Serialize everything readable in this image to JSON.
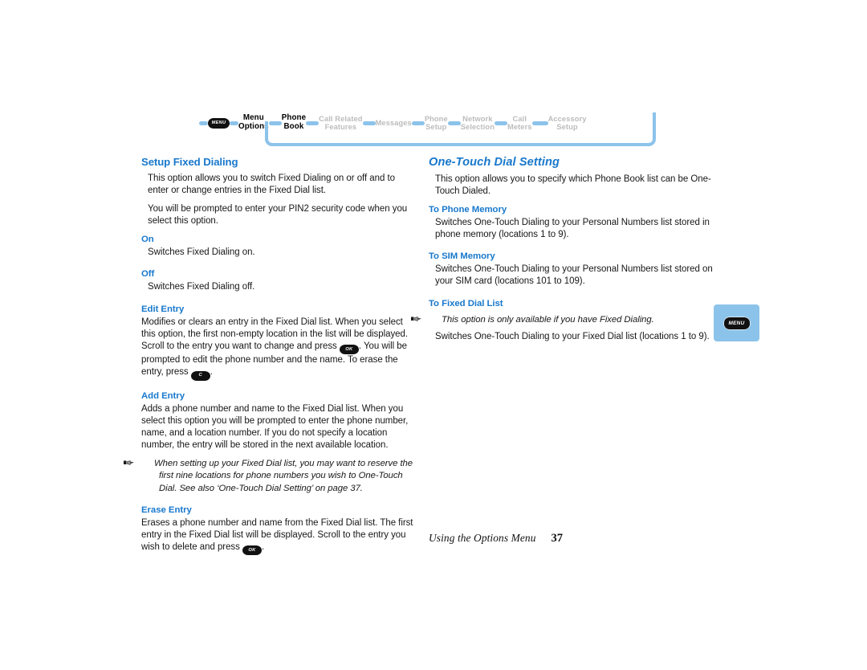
{
  "nav": {
    "menu_icon_label": "MENU",
    "items": [
      {
        "lines": [
          "Menu",
          "Options"
        ],
        "state": "active"
      },
      {
        "lines": [
          "Phone",
          "Book"
        ],
        "state": "active"
      },
      {
        "lines": [
          "Call Related",
          "Features"
        ],
        "state": "dim"
      },
      {
        "lines": [
          "Messages"
        ],
        "state": "dim"
      },
      {
        "lines": [
          "Phone",
          "Setup"
        ],
        "state": "dim"
      },
      {
        "lines": [
          "Network",
          "Selection"
        ],
        "state": "dim"
      },
      {
        "lines": [
          "Call",
          "Meters"
        ],
        "state": "dim"
      },
      {
        "lines": [
          "Accessory",
          "Setup"
        ],
        "state": "dim"
      }
    ]
  },
  "colors": {
    "heading_blue": "#1878cc",
    "connector_blue": "#8cc3ea",
    "dim_gray": "#bcbcbc",
    "body_text": "#171717"
  },
  "left_column": {
    "title": "Setup Fixed Dialing",
    "intro_1": "This option allows you to switch Fixed Dialing on or off and to enter or change entries in the Fixed Dial list.",
    "intro_2": "You will be prompted to enter your PIN2 security code when you select this option.",
    "on": {
      "title": "On",
      "body": "Switches Fixed Dialing on."
    },
    "off": {
      "title": "Off",
      "body": "Switches Fixed Dialing off."
    },
    "edit_entry": {
      "title": "Edit Entry",
      "body_part1": "Modifies or clears an entry in the Fixed Dial list. When you select this option, the first non-empty location in the list will be displayed. Scroll to the entry you want to change and press",
      "key_ok": "OK",
      "body_part2": ". You will be prompted to edit the phone number and the name. To erase the entry, press",
      "key_c": "C",
      "body_part3": "."
    },
    "add_entry": {
      "title": "Add Entry",
      "body": "Adds a phone number and name to the Fixed Dial list. When you select this option you will be prompted to enter the phone number, name, and a location number. If you do not specify a location number, the entry will be stored in the next available location.",
      "note": "When setting up your Fixed Dial list, you may want to reserve the first nine locations for phone numbers you wish to One-Touch Dial. See also ‘One-Touch Dial Setting’ on page 37."
    },
    "erase_entry": {
      "title": "Erase Entry",
      "body_part1": "Erases a phone number and name from the Fixed Dial list. The first entry in the Fixed Dial list will be displayed. Scroll to the entry you wish to delete and press",
      "key_ok": "OK",
      "body_part2": "."
    }
  },
  "right_column": {
    "title": "One-Touch Dial Setting",
    "intro": "This option allows you to specify which Phone Book list can be One-Touch Dialed.",
    "to_phone_memory": {
      "title": "To Phone Memory",
      "body": "Switches One-Touch Dialing to your Personal Numbers list stored in phone memory (locations 1 to 9)."
    },
    "to_sim_memory": {
      "title": "To SIM Memory",
      "body": "Switches One-Touch Dialing to your Personal Numbers list stored on your SIM card (locations 101 to 109)."
    },
    "to_fixed_dial_list": {
      "title": "To Fixed Dial List",
      "note": "This option is only available if you have Fixed Dialing.",
      "body": "Switches One-Touch Dialing to your Fixed Dial list (locations 1 to 9)."
    }
  },
  "side_tab": {
    "label": "MENU"
  },
  "footer": {
    "label": "Using the Options Menu",
    "page": "37"
  }
}
